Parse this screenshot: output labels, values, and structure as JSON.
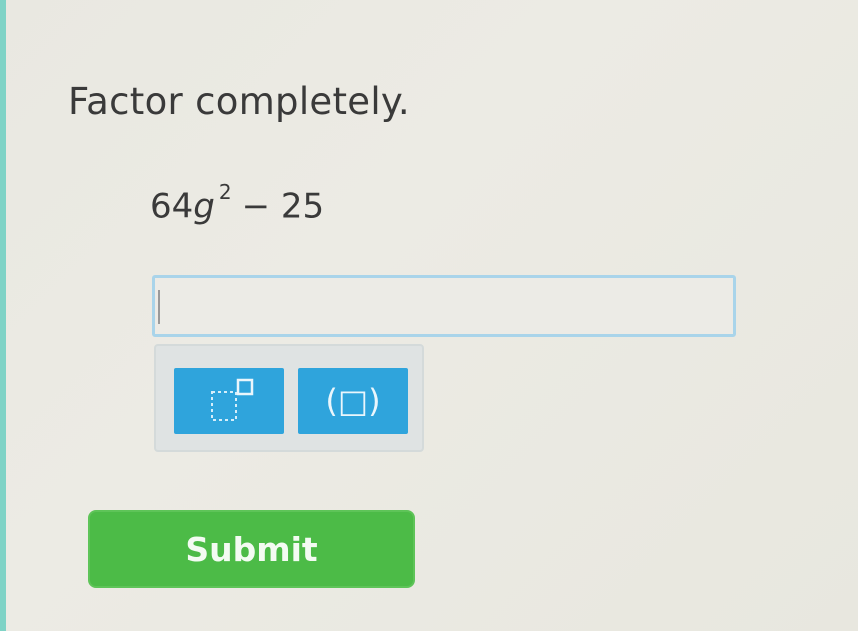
{
  "question": {
    "instruction": "Factor completely.",
    "expression": {
      "coefficient": "64",
      "variable": "g",
      "exponent": "2",
      "operator": "−",
      "constant": "25"
    }
  },
  "answer": {
    "value": "",
    "placeholder": ""
  },
  "keypad": {
    "exponent_key": "exponent-template-icon",
    "parens_key": "(□)"
  },
  "actions": {
    "submit_label": "Submit"
  },
  "colors": {
    "key_blue": "#2fa4dc",
    "submit_green": "#4cbb47",
    "input_border": "#a9d4ea",
    "left_accent": "#7fd3c6"
  }
}
